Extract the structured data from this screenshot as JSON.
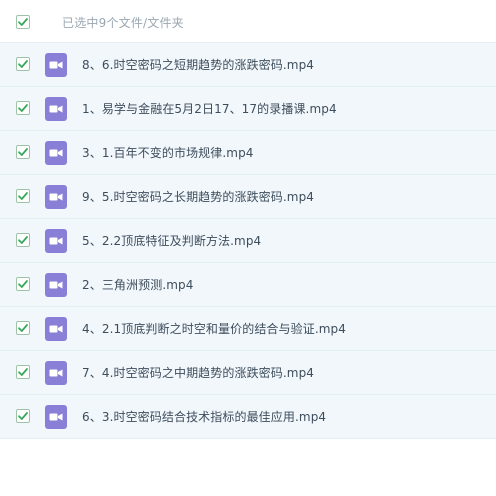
{
  "header": {
    "selection_text": "已选中9个文件/文件夹",
    "checked": true
  },
  "files": [
    {
      "name": "8、6.时空密码之短期趋势的涨跌密码.mp4",
      "checked": true,
      "icon": "video-file-icon"
    },
    {
      "name": "1、易学与金融在5月2日17、17的录播课.mp4",
      "checked": true,
      "icon": "video-file-icon"
    },
    {
      "name": "3、1.百年不变的市场规律.mp4",
      "checked": true,
      "icon": "video-file-icon"
    },
    {
      "name": "9、5.时空密码之长期趋势的涨跌密码.mp4",
      "checked": true,
      "icon": "video-file-icon"
    },
    {
      "name": "5、2.2顶底特征及判断方法.mp4",
      "checked": true,
      "icon": "video-file-icon"
    },
    {
      "name": "2、三角洲预测.mp4",
      "checked": true,
      "icon": "video-file-icon"
    },
    {
      "name": "4、2.1顶底判断之时空和量价的结合与验证.mp4",
      "checked": true,
      "icon": "video-file-icon"
    },
    {
      "name": "7、4.时空密码之中期趋势的涨跌密码.mp4",
      "checked": true,
      "icon": "video-file-icon"
    },
    {
      "name": "6、3.时空密码结合技术指标的最佳应用.mp4",
      "checked": true,
      "icon": "video-file-icon"
    }
  ],
  "colors": {
    "check": "#3aa85c",
    "icon_bg": "#8a7fd6",
    "row_bg": "#f1f7fb"
  }
}
